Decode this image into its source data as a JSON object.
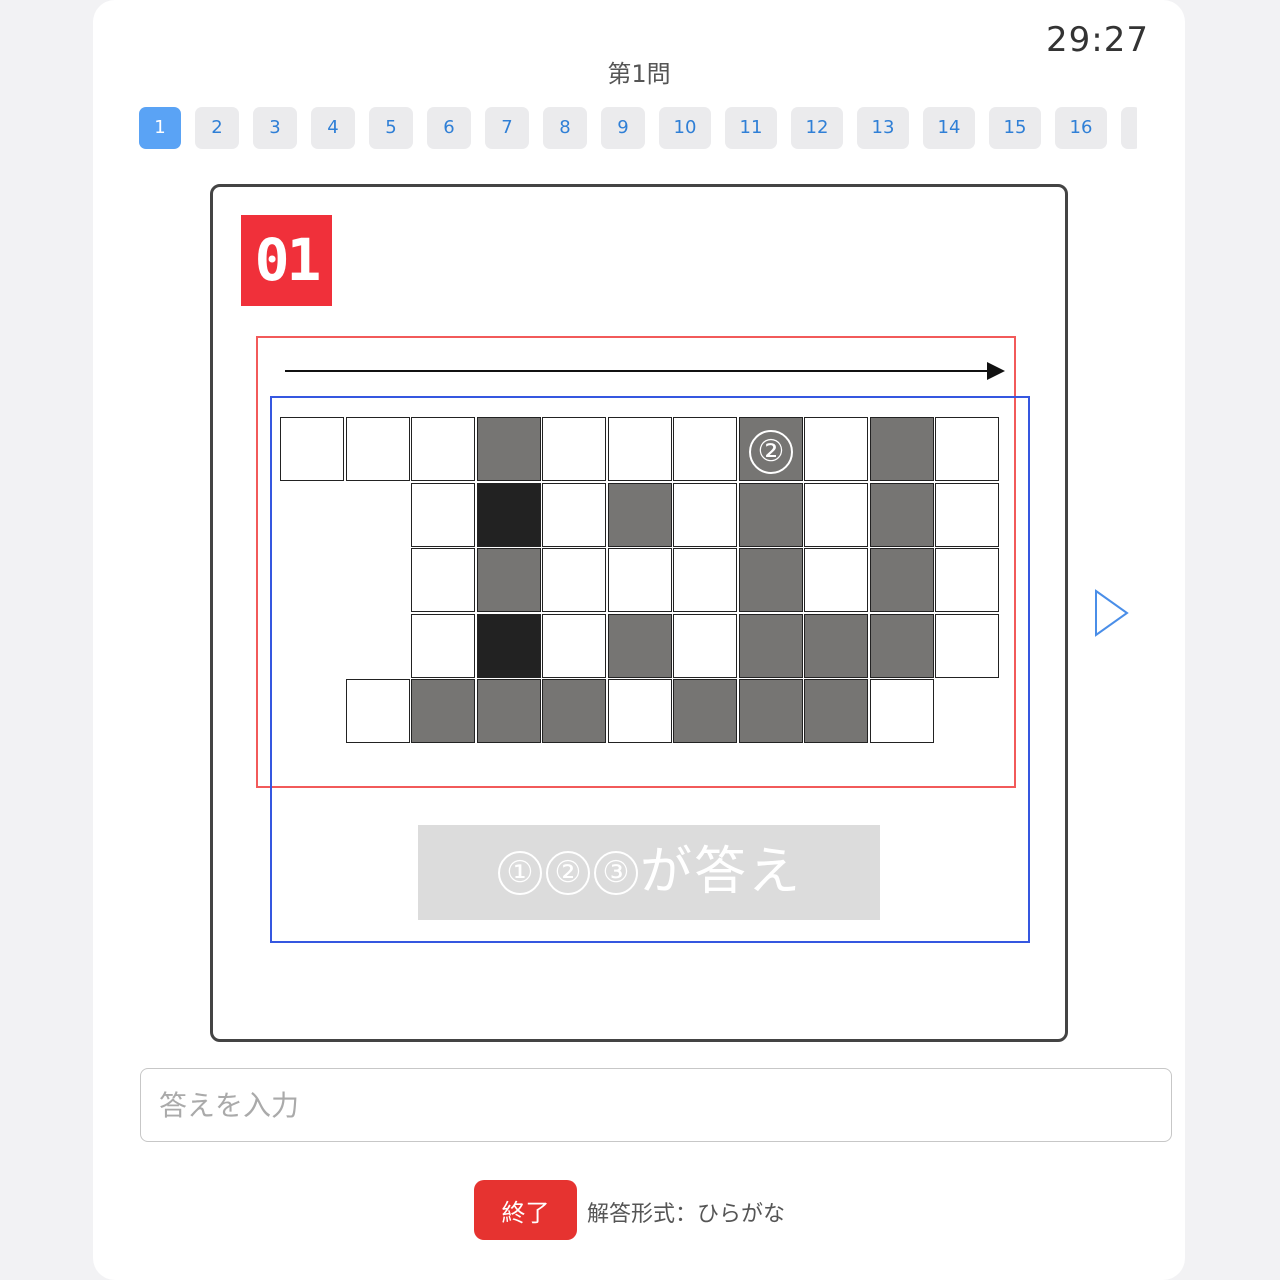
{
  "timer": "29:27",
  "question_title": "第1問",
  "question_nav": [
    "1",
    "2",
    "3",
    "4",
    "5",
    "6",
    "7",
    "8",
    "9",
    "10",
    "11",
    "12",
    "13",
    "14",
    "15",
    "16",
    ""
  ],
  "active_question": "1",
  "puzzle": {
    "badge": "01",
    "marker_label": "②",
    "grid_rows": [
      "wwwgwwwgwgw",
      "..wdwgwgwgw",
      "..wgwwwgwgw",
      "..wdwgwgggw",
      ".wgggwgggw"
    ],
    "answer_banner_nums": [
      "①",
      "②",
      "③"
    ],
    "answer_banner_text": "が答え"
  },
  "next_icon": "play-triangle-icon",
  "answer_input": {
    "placeholder": "答えを入力",
    "value": ""
  },
  "end_button_label": "終了",
  "answer_format": "解答形式：ひらがな",
  "colors": {
    "accent_blue": "#5aa3f5",
    "badge_red": "#f0303a",
    "end_button_red": "#e63330",
    "highlight_red": "#f25a5a",
    "highlight_blue": "#3557e0",
    "cell_gray": "#767573",
    "cell_dark": "#222222"
  }
}
